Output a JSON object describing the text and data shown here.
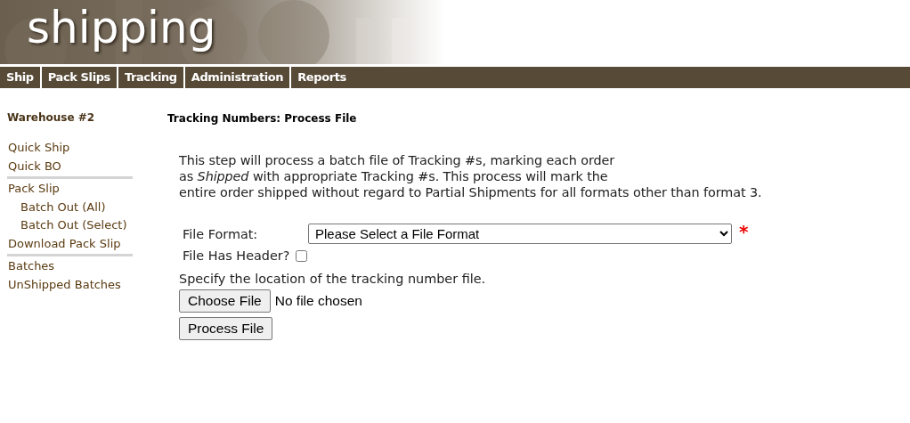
{
  "header": {
    "logo": "shipping"
  },
  "nav": [
    {
      "label": "Ship"
    },
    {
      "label": "Pack Slips"
    },
    {
      "label": "Tracking"
    },
    {
      "label": "Administration"
    },
    {
      "label": "Reports"
    }
  ],
  "sidebar": {
    "title": "Warehouse #2",
    "groups": [
      {
        "items": [
          {
            "label": "Quick Ship"
          },
          {
            "label": "Quick BO"
          }
        ]
      },
      {
        "items": [
          {
            "label": "Pack Slip",
            "children": [
              {
                "label": "Batch Out (All)"
              },
              {
                "label": "Batch Out (Select)"
              }
            ]
          },
          {
            "label": "Download Pack Slip"
          }
        ]
      },
      {
        "items": [
          {
            "label": "Batches"
          },
          {
            "label": "UnShipped Batches"
          }
        ]
      }
    ]
  },
  "main": {
    "title": "Tracking Numbers: Process File",
    "description": [
      "This step will process a batch file of Tracking #s, marking each order",
      "as *Shipped* with appropriate Tracking #s. This process will mark the",
      "entire order shipped without regard to Partial Shipments for all formats other than format 3."
    ],
    "file_format": {
      "label": "File Format:",
      "value": "Please Select a File Format",
      "required_mark": "*"
    },
    "has_header": {
      "label": "File Has Header?",
      "checked": false
    },
    "file_prompt": "Specify the location of the tracking number file.",
    "file_input": {
      "button": "Choose File",
      "status": "No file chosen"
    },
    "submit": "Process File"
  }
}
